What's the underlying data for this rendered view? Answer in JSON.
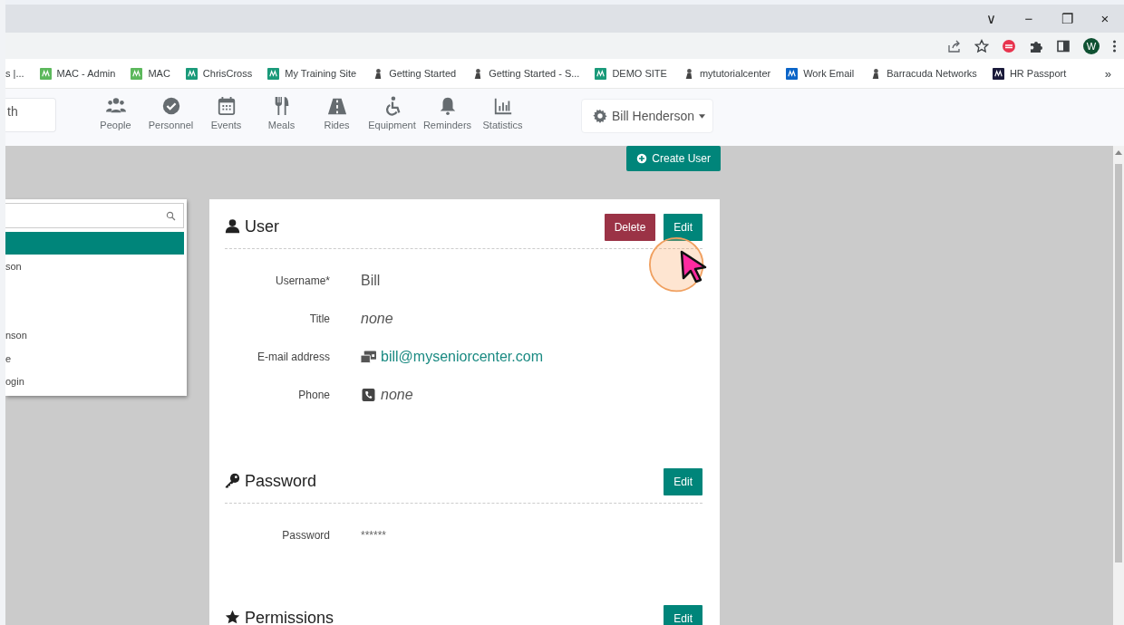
{
  "browser": {
    "window_controls": [
      "∨",
      "−",
      "❐",
      "×"
    ],
    "profile_initial": "W",
    "bookmarks": [
      {
        "label": "s |..."
      },
      {
        "label": "MAC - Admin"
      },
      {
        "label": "MAC"
      },
      {
        "label": "ChrisCross"
      },
      {
        "label": "My Training Site"
      },
      {
        "label": "Getting Started"
      },
      {
        "label": "Getting Started - S..."
      },
      {
        "label": "DEMO SITE"
      },
      {
        "label": "mytutorialcenter"
      },
      {
        "label": "Work Email"
      },
      {
        "label": "Barracuda Networks"
      },
      {
        "label": "HR Passport"
      }
    ],
    "overflow": "»"
  },
  "header": {
    "search_value": "th",
    "nav": [
      {
        "label": "People"
      },
      {
        "label": "Personnel"
      },
      {
        "label": "Events"
      },
      {
        "label": "Meals"
      },
      {
        "label": "Rides"
      },
      {
        "label": "Equipment"
      },
      {
        "label": "Reminders"
      },
      {
        "label": "Statistics"
      }
    ],
    "account": "Bill Henderson"
  },
  "create_button": "Create User",
  "user_list": {
    "items": [
      {
        "selected": true
      },
      {
        "label": "son",
        "selected": false
      },
      {
        "selected": false
      },
      {
        "selected": false
      },
      {
        "label": "nson",
        "selected": false
      },
      {
        "label": "e",
        "selected": false
      },
      {
        "label": "ogin",
        "selected": false
      }
    ]
  },
  "sections": [
    {
      "title": "User",
      "buttons": [
        {
          "label": "Delete",
          "kind": "danger"
        },
        {
          "label": "Edit",
          "kind": "primary"
        }
      ],
      "fields": [
        {
          "label": "Username*",
          "value": "Bill",
          "kind": "text"
        },
        {
          "label": "Title",
          "value": "none",
          "kind": "empty"
        },
        {
          "label": "E-mail address",
          "value": "bill@myseniorcenter.com",
          "kind": "email"
        },
        {
          "label": "Phone",
          "value": "none",
          "kind": "phone"
        }
      ]
    },
    {
      "title": "Password",
      "buttons": [
        {
          "label": "Edit",
          "kind": "primary"
        }
      ],
      "fields": [
        {
          "label": "Password",
          "value": "******",
          "kind": "secret"
        }
      ]
    },
    {
      "title": "Permissions",
      "buttons": [
        {
          "label": "Edit",
          "kind": "primary"
        }
      ]
    }
  ],
  "click_highlight": true
}
